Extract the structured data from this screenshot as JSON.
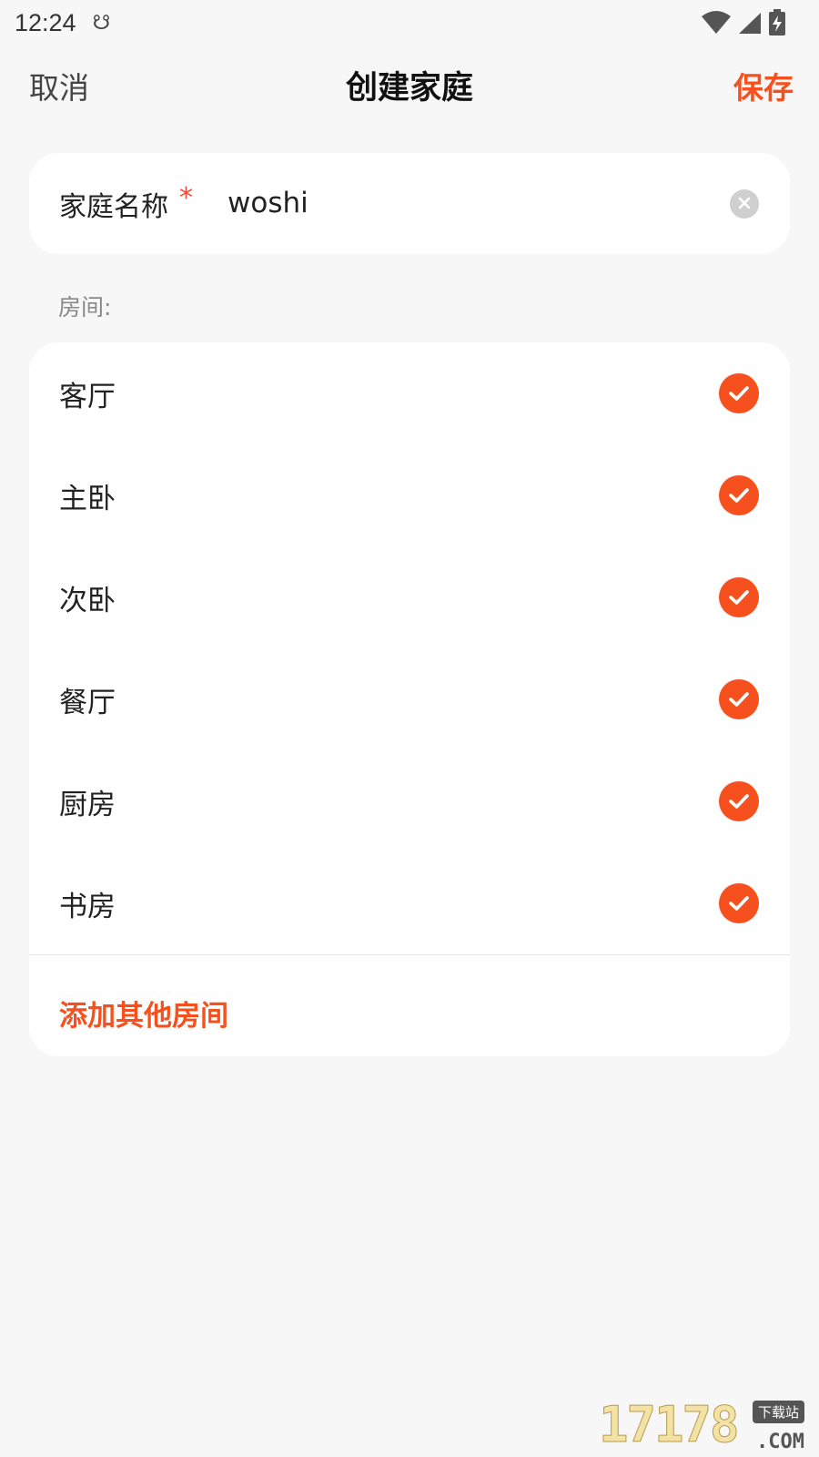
{
  "status_bar": {
    "time": "12:24",
    "notification_glyph": "☋",
    "icons": [
      "wifi-icon",
      "cell-signal-icon",
      "battery-charging-icon"
    ]
  },
  "nav": {
    "cancel_label": "取消",
    "title": "创建家庭",
    "save_label": "保存"
  },
  "name_field": {
    "label": "家庭名称",
    "required_mark": "*",
    "value": "woshi"
  },
  "rooms_section": {
    "label": "房间:",
    "rooms": [
      {
        "name": "客厅",
        "checked": true
      },
      {
        "name": "主卧",
        "checked": true
      },
      {
        "name": "次卧",
        "checked": true
      },
      {
        "name": "餐厅",
        "checked": true
      },
      {
        "name": "厨房",
        "checked": true
      },
      {
        "name": "书房",
        "checked": true
      }
    ],
    "add_label": "添加其他房间"
  },
  "watermark": {
    "digits": "17178",
    "badge": "下载站",
    "suffix": ".COM"
  },
  "colors": {
    "accent": "#f5501e",
    "background": "#f7f7f7",
    "card": "#ffffff",
    "required": "#f04a3a"
  }
}
